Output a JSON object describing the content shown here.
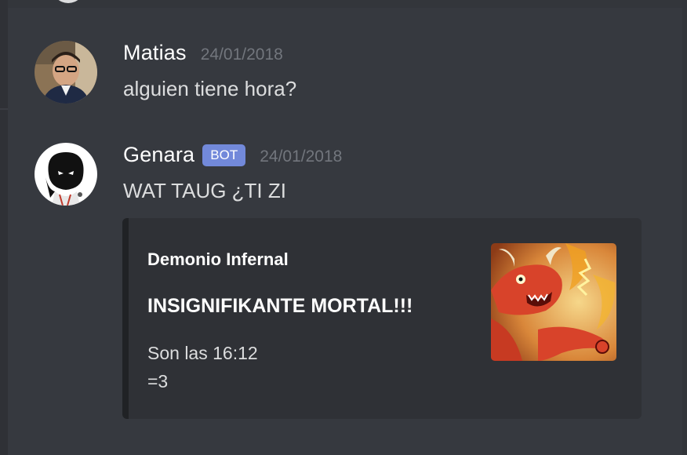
{
  "messages": [
    {
      "username": "Matias",
      "timestamp": "24/01/2018",
      "content": "alguien tiene hora?",
      "avatar_icon": "user-photo-avatar"
    },
    {
      "username": "Genara",
      "bot_tag": "BOT",
      "timestamp": "24/01/2018",
      "content": "WAT TAUG ¿TI ZI",
      "avatar_icon": "dark-character-avatar",
      "embed": {
        "author": "Demonio Infernal",
        "title": "INSIGNIFIKANTE MORTAL!!!",
        "description_lines": [
          "Son las 16:12",
          "=3"
        ],
        "thumbnail_icon": "red-demon-thumbnail",
        "border_color": "#202225"
      }
    }
  ],
  "colors": {
    "background": "#36393f",
    "username": "#ffffff",
    "timestamp": "#72767d",
    "message_text": "#dcddde",
    "bot_tag": "#7289da",
    "embed_background": "#2f3136"
  }
}
